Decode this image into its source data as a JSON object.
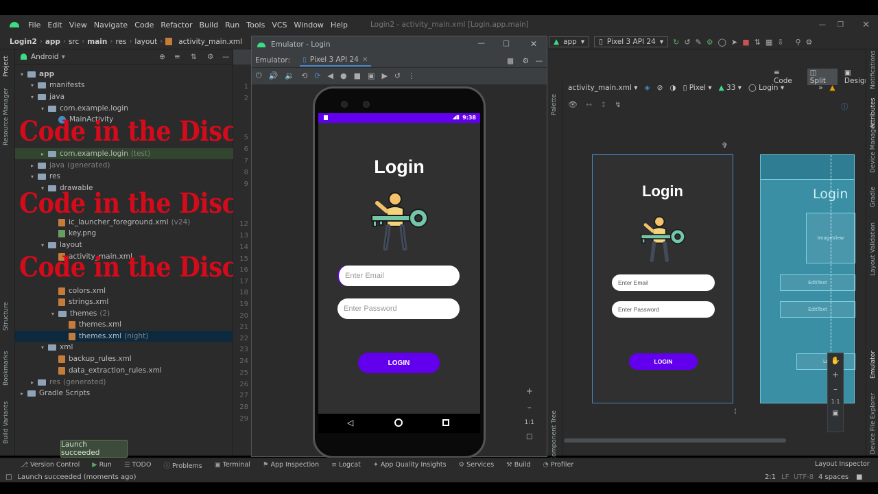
{
  "window_title": "Login2 - activity_main.xml [Login.app.main]",
  "menu": [
    "File",
    "Edit",
    "View",
    "Navigate",
    "Code",
    "Refactor",
    "Build",
    "Run",
    "Tools",
    "VCS",
    "Window",
    "Help"
  ],
  "breadcrumb": [
    "Login2",
    "app",
    "src",
    "main",
    "res",
    "layout",
    "activity_main.xml"
  ],
  "toolbar": {
    "run_config": "app",
    "device": "Pixel 3 API 24"
  },
  "project_panel": {
    "view_mode": "Android",
    "tree": [
      {
        "label": "app",
        "depth": 0,
        "type": "folder",
        "bold": true
      },
      {
        "label": "manifests",
        "depth": 1,
        "type": "folder"
      },
      {
        "label": "java",
        "depth": 1,
        "type": "folder"
      },
      {
        "label": "com.example.login",
        "depth": 2,
        "type": "folder"
      },
      {
        "label": "MainActivity",
        "depth": 3,
        "type": "class"
      },
      {
        "label": "com.example.login",
        "suffix": "(test)",
        "depth": 2,
        "type": "folder"
      },
      {
        "label": "java",
        "suffix": "(generated)",
        "depth": 1,
        "type": "folder",
        "muted": true
      },
      {
        "label": "res",
        "depth": 1,
        "type": "folder"
      },
      {
        "label": "drawable",
        "depth": 2,
        "type": "folder"
      },
      {
        "label": "ic_launcher_foreground.xml",
        "suffix": "(v24)",
        "depth": 3,
        "type": "xml"
      },
      {
        "label": "key.png",
        "depth": 3,
        "type": "png"
      },
      {
        "label": "layout",
        "depth": 2,
        "type": "folder"
      },
      {
        "label": "activity_main.xml",
        "depth": 3,
        "type": "xml"
      },
      {
        "label": "colors.xml",
        "depth": 3,
        "type": "xml"
      },
      {
        "label": "strings.xml",
        "depth": 3,
        "type": "xml"
      },
      {
        "label": "themes",
        "suffix": "(2)",
        "depth": 3,
        "type": "folder"
      },
      {
        "label": "themes.xml",
        "depth": 4,
        "type": "xml"
      },
      {
        "label": "themes.xml",
        "suffix": "(night)",
        "depth": 4,
        "type": "xml",
        "selected": true
      },
      {
        "label": "xml",
        "depth": 2,
        "type": "folder"
      },
      {
        "label": "backup_rules.xml",
        "depth": 3,
        "type": "xml"
      },
      {
        "label": "data_extraction_rules.xml",
        "depth": 3,
        "type": "xml"
      },
      {
        "label": "res",
        "suffix": "(generated)",
        "depth": 1,
        "type": "folder",
        "muted": true
      },
      {
        "label": "Gradle Scripts",
        "depth": 0,
        "type": "folder"
      }
    ]
  },
  "overlay_text": "Code  in the Discription",
  "toast": "Launch succeeded",
  "emulator": {
    "title": "Emulator - Login",
    "label": "Emulator:",
    "tab": "Pixel 3 API 24",
    "time": "9:38",
    "app": {
      "title": "Login",
      "email_placeholder": "Enter Email",
      "password_placeholder": "Enter Password",
      "button": "LOGIN"
    }
  },
  "gutter_lines": [
    "1",
    "2",
    "5",
    "6",
    "7",
    "8",
    "9",
    "12",
    "13",
    "14",
    "15",
    "16",
    "17",
    "18",
    "19",
    "20",
    "21",
    "22",
    "23",
    "24",
    "25",
    "26",
    "27",
    "28",
    "29"
  ],
  "design": {
    "modes": [
      "Code",
      "Split",
      "Design"
    ],
    "file": "activity_main.xml",
    "device": "Pixel",
    "api": "33",
    "theme": "Login",
    "preview": {
      "title": "Login",
      "email": "Enter Email",
      "password": "Enter Password",
      "button": "LOGIN"
    },
    "blueprint": {
      "title": "Login",
      "image": "ImageView",
      "edit1": "EditText",
      "edit2": "EditText",
      "button": "Lo"
    },
    "zoom_ratio": "1:1",
    "palette": "Palette",
    "component_tree": "Component Tree",
    "attributes": "Attributes"
  },
  "bottom_tabs": [
    "Version Control",
    "Run",
    "TODO",
    "Problems",
    "Terminal",
    "App Inspection",
    "Logcat",
    "App Quality Insights",
    "Services",
    "Build",
    "Profiler"
  ],
  "layout_inspector": "Layout Inspector",
  "status": {
    "message": "Launch succeeded (moments ago)",
    "position": "2:1",
    "line_sep": "LF",
    "encoding": "UTF-8",
    "indent": "4 spaces"
  },
  "left_tools": [
    "Project",
    "Resource Manager",
    "Structure",
    "Bookmarks",
    "Build Variants"
  ],
  "right_tools": [
    "Notifications",
    "Device Manager",
    "Gradle",
    "Layout Validation",
    "Emulator",
    "Device File Explorer"
  ]
}
